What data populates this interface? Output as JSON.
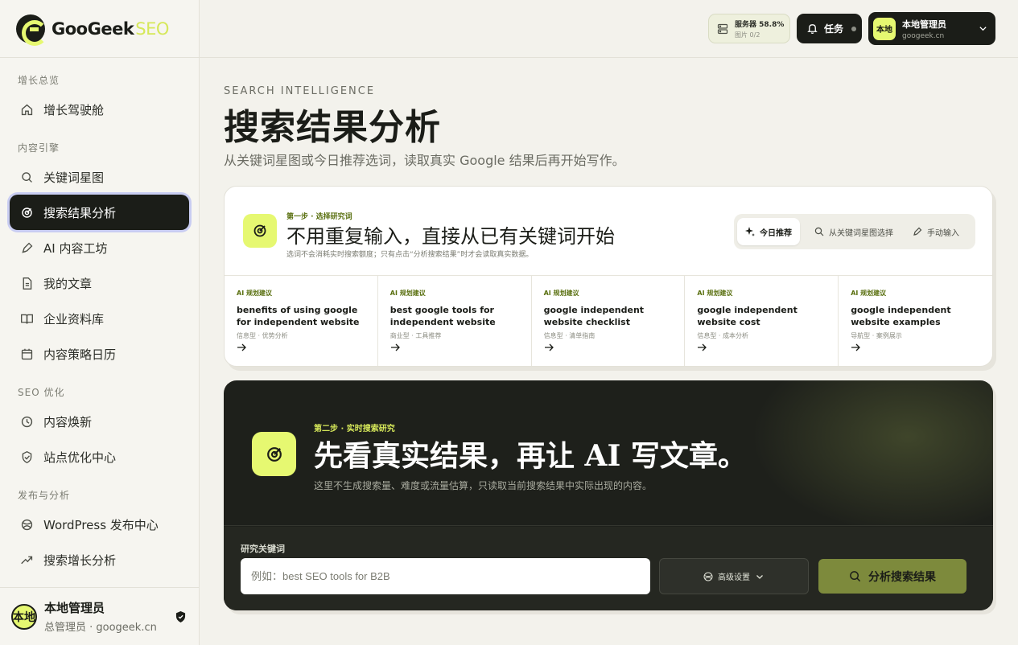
{
  "brand": {
    "name": "GooGeek",
    "suffix": "SEO"
  },
  "sidebar": {
    "sections": [
      {
        "title": "增长总览",
        "items": [
          {
            "label": "增长驾驶舱",
            "icon": "home-icon"
          }
        ]
      },
      {
        "title": "内容引擎",
        "items": [
          {
            "label": "关键词星图",
            "icon": "search-icon"
          },
          {
            "label": "搜索结果分析",
            "icon": "target-icon",
            "active": true
          },
          {
            "label": "AI 内容工坊",
            "icon": "pen-icon"
          },
          {
            "label": "我的文章",
            "icon": "document-icon"
          },
          {
            "label": "企业资料库",
            "icon": "book-icon"
          },
          {
            "label": "内容策略日历",
            "icon": "calendar-icon"
          }
        ]
      },
      {
        "title": "SEO 优化",
        "items": [
          {
            "label": "内容焕新",
            "icon": "clock-icon"
          },
          {
            "label": "站点优化中心",
            "icon": "shield-check-icon"
          }
        ]
      },
      {
        "title": "发布与分析",
        "items": [
          {
            "label": "WordPress 发布中心",
            "icon": "globe-icon"
          },
          {
            "label": "搜索增长分析",
            "icon": "trend-icon"
          }
        ]
      }
    ],
    "user": {
      "avatar": "本地",
      "name": "本地管理员",
      "role": "总管理员 · googeek.cn"
    }
  },
  "topbar": {
    "server": {
      "label": "服务器 58.8%",
      "sub": "图片 0/2"
    },
    "tasks": {
      "label": "任务"
    },
    "account": {
      "avatar": "本地",
      "name": "本地管理员",
      "domain": "googeek.cn"
    }
  },
  "page": {
    "eyebrow": "SEARCH INTELLIGENCE",
    "title": "搜索结果分析",
    "subtitle": "从关键词星图或今日推荐选词，读取真实 Google 结果后再开始写作。"
  },
  "step1": {
    "kicker": "第一步 · 选择研究词",
    "title": "不用重复输入，直接从已有关键词开始",
    "note": "选词不会消耗实时搜索额度；只有点击“分析搜索结果”时才会读取真实数据。",
    "tabs": [
      {
        "label": "今日推荐",
        "icon": "sparkle-icon",
        "active": true
      },
      {
        "label": "从关键词星图选择",
        "icon": "search-icon"
      },
      {
        "label": "手动输入",
        "icon": "pen-icon"
      }
    ],
    "suggestions": [
      {
        "tag": "AI 规划建议",
        "keyword": "benefits of using google for independent website",
        "meta": "信息型 · 优势分析"
      },
      {
        "tag": "AI 规划建议",
        "keyword": "best google tools for independent website",
        "meta": "商业型 · 工具推荐"
      },
      {
        "tag": "AI 规划建议",
        "keyword": "google independent website checklist",
        "meta": "信息型 · 清单指南"
      },
      {
        "tag": "AI 规划建议",
        "keyword": "google independent website cost",
        "meta": "信息型 · 成本分析"
      },
      {
        "tag": "AI 规划建议",
        "keyword": "google independent website examples",
        "meta": "导航型 · 案例展示"
      }
    ]
  },
  "step2": {
    "kicker": "第二步 · 实时搜索研究",
    "title": "先看真实结果，再让 AI 写文章。",
    "subtitle": "这里不生成搜索量、难度或流量估算，只读取当前搜索结果中实际出现的内容。",
    "keyword_label": "研究关键词",
    "keyword_placeholder": "例如：best SEO tools for B2B",
    "keyword_value": "",
    "advanced_label": "高级设置",
    "analyze_label": "分析搜索结果"
  },
  "colors": {
    "accent": "#e6f871",
    "dark": "#1b1d18",
    "olive": "#7d8a3c"
  }
}
